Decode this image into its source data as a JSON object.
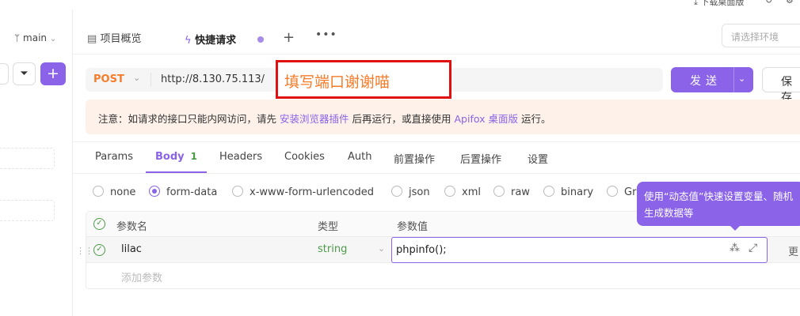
{
  "topbar": {
    "download_label": "下载桌面版"
  },
  "sidebar": {
    "branch": "main"
  },
  "tabs": [
    {
      "label": "项目概览"
    },
    {
      "label": "快捷请求"
    }
  ],
  "environment": {
    "placeholder": "请选择环境"
  },
  "request": {
    "method": "POST",
    "url": "http://8.130.75.113/",
    "overlay_note": "填写端口谢谢喵",
    "send_label": "发送",
    "save_label": "保存"
  },
  "notice": {
    "prefix": "注意：如请求的接口只能内网访问，请先",
    "link1": "安装浏览器插件",
    "middle": "后再运行，或直接使用",
    "link2": "Apifox 桌面版",
    "suffix": "运行。"
  },
  "subtabs": [
    {
      "label": "Params"
    },
    {
      "label": "Body",
      "count": "1"
    },
    {
      "label": "Headers"
    },
    {
      "label": "Cookies"
    },
    {
      "label": "Auth"
    },
    {
      "label": "前置操作"
    },
    {
      "label": "后置操作"
    },
    {
      "label": "设置"
    }
  ],
  "body_types": {
    "selected": "form-data",
    "options": [
      "none",
      "form-data",
      "x-www-form-urlencoded",
      "json",
      "xml",
      "raw",
      "binary",
      "Gr"
    ]
  },
  "params_table": {
    "headers": [
      "参数名",
      "类型",
      "参数值"
    ],
    "rows": [
      {
        "name": "lilac",
        "type": "string",
        "value": "phpinfo();",
        "more": "更"
      }
    ],
    "add_placeholder": "添加参数"
  },
  "tooltip": {
    "text": "使用“动态值”快速设置变量、随机生成数据等"
  },
  "colors": {
    "accent": "#8a63e8",
    "method": "#f57c2b",
    "success": "#4c9a49",
    "notice_bg": "#fdf1ea",
    "overlay_border": "#e01010"
  }
}
